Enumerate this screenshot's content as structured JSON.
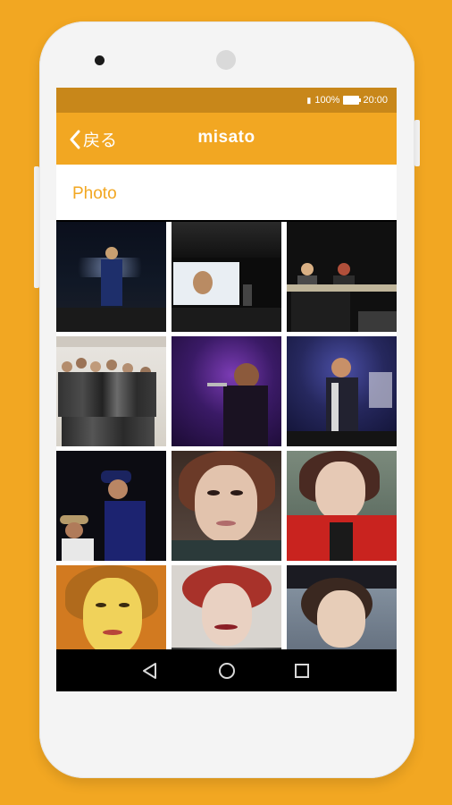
{
  "status_bar": {
    "battery": "100%",
    "time": "20:00"
  },
  "app_bar": {
    "back_label": "戻る",
    "title": "misato"
  },
  "section": {
    "title": "Photo"
  },
  "photos": [
    "concert-stage-photo",
    "projection-screen-photo",
    "panel-talk-photo",
    "group-backstage-photo",
    "purple-stage-singing-photo",
    "blue-stage-singing-photo",
    "hat-duet-photo",
    "selfie-photo-1",
    "selfie-photo-2",
    "selfie-photo-3",
    "selfie-photo-4",
    "selfie-photo-5"
  ],
  "colors": {
    "accent": "#F2A722",
    "status_bar": "#C8871A"
  }
}
